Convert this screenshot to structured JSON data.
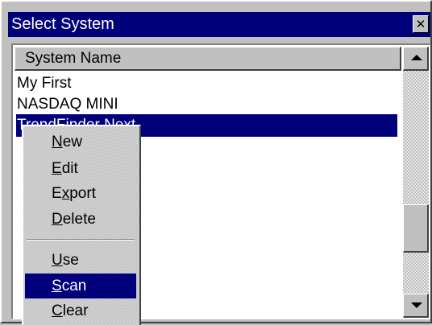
{
  "window": {
    "title": "Select System",
    "close_glyph": "✕"
  },
  "list": {
    "column_header": "System Name",
    "rows": [
      {
        "label": "My First",
        "selected": false
      },
      {
        "label": "NASDAQ MINI",
        "selected": false
      },
      {
        "label": "TrendFinder Next",
        "selected": true
      }
    ]
  },
  "context_menu": {
    "items": [
      {
        "pre": "",
        "key": "N",
        "post": "ew",
        "highlighted": false
      },
      {
        "pre": "",
        "key": "E",
        "post": "dit",
        "highlighted": false
      },
      {
        "pre": "E",
        "key": "x",
        "post": "port",
        "highlighted": false
      },
      {
        "pre": "",
        "key": "D",
        "post": "elete",
        "highlighted": false
      },
      {
        "pre": "",
        "key": "U",
        "post": "se",
        "highlighted": false
      },
      {
        "pre": "",
        "key": "S",
        "post": "can",
        "highlighted": true
      },
      {
        "pre": "",
        "key": "C",
        "post": "lear",
        "highlighted": false
      }
    ]
  },
  "colors": {
    "titlebar": "#00007b",
    "selection": "#00007b",
    "face": "#c0c0c0"
  }
}
